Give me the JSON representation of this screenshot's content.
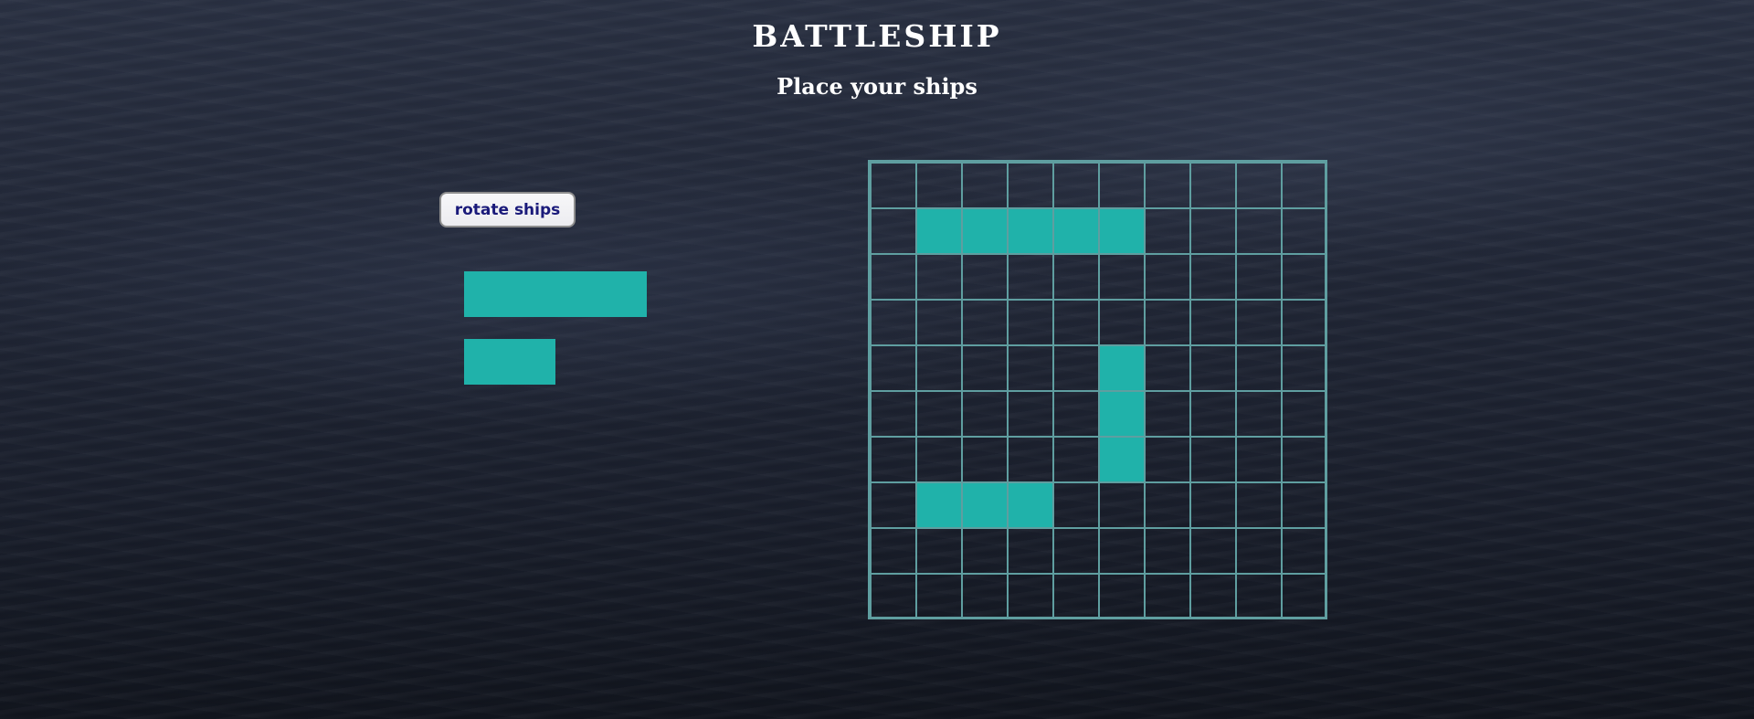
{
  "game": {
    "title": "BATTLESHIP",
    "subtitle": "Place your ships"
  },
  "controls": {
    "rotate_label": "rotate ships"
  },
  "colors": {
    "ship": "#20b2aa",
    "grid": "#5f9ea0",
    "title_text": "#ffffff",
    "button_text": "#1a1a7a"
  },
  "dock": {
    "ships": [
      {
        "name": "ship-length-4",
        "length": 4
      },
      {
        "name": "ship-length-2",
        "length": 2
      }
    ]
  },
  "board": {
    "rows": 10,
    "cols": 10,
    "placed_ships": [
      {
        "row": 1,
        "col": 1,
        "length": 5,
        "orientation": "horizontal"
      },
      {
        "row": 4,
        "col": 5,
        "length": 3,
        "orientation": "vertical"
      },
      {
        "row": 7,
        "col": 1,
        "length": 3,
        "orientation": "horizontal"
      }
    ]
  }
}
